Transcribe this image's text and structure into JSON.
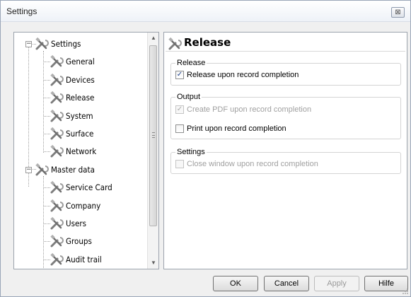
{
  "window": {
    "title": "Settings",
    "close_glyph": "⊠"
  },
  "tree": {
    "items": [
      {
        "label": "Settings",
        "level": 0,
        "expander": "−",
        "icon": "tools-icon"
      },
      {
        "label": "General",
        "level": 1,
        "icon": "tools-icon"
      },
      {
        "label": "Devices",
        "level": 1,
        "icon": "tools-icon"
      },
      {
        "label": "Release",
        "level": 1,
        "icon": "tools-icon",
        "selected": true
      },
      {
        "label": "System",
        "level": 1,
        "icon": "tools-icon"
      },
      {
        "label": "Surface",
        "level": 1,
        "icon": "tools-icon"
      },
      {
        "label": "Network",
        "level": 1,
        "icon": "tools-icon"
      },
      {
        "label": "Master data",
        "level": 0,
        "expander": "−",
        "icon": "tools-icon"
      },
      {
        "label": "Service Card",
        "level": 1,
        "icon": "tools-icon"
      },
      {
        "label": "Company",
        "level": 1,
        "icon": "tools-icon"
      },
      {
        "label": "Users",
        "level": 1,
        "icon": "tools-icon"
      },
      {
        "label": "Groups",
        "level": 1,
        "icon": "tools-icon"
      },
      {
        "label": "Audit trail",
        "level": 1,
        "icon": "tools-icon"
      }
    ],
    "scroll_up": "▲",
    "scroll_down": "▼"
  },
  "page": {
    "title": "Release",
    "groups": [
      {
        "label": "Release",
        "options": [
          {
            "label": "Release upon record completion",
            "checked": true,
            "enabled": true
          }
        ]
      },
      {
        "label": "Output",
        "options": [
          {
            "label": "Create PDF upon record completion",
            "checked": true,
            "enabled": false
          },
          {
            "label": "Print upon record completion",
            "checked": false,
            "enabled": true
          }
        ]
      },
      {
        "label": "Settings",
        "options": [
          {
            "label": "Close window upon record completion",
            "checked": false,
            "enabled": false
          }
        ]
      }
    ]
  },
  "buttons": {
    "ok": "OK",
    "cancel": "Cancel",
    "apply": "Apply",
    "help": "Hilfe"
  },
  "check_glyph": "✓"
}
